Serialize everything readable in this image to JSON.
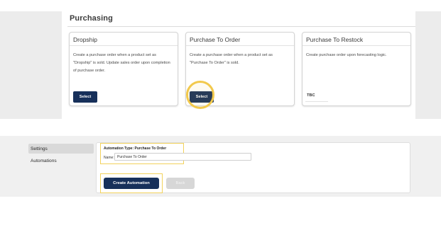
{
  "purchasing": {
    "title": "Purchasing",
    "cards": [
      {
        "title": "Dropship",
        "description": "Create a purchase order when a product set as \"Dropship\" is sold. Update sales order upon completion of purchase order.",
        "action_label": "Select"
      },
      {
        "title": "Purchase To Order",
        "description": "Create a purchase order when a product set as \"Purchase To Order\" is sold.",
        "action_label": "Select"
      },
      {
        "title": "Purchase To Restock",
        "description": "Create purchase order upon forecasting logic.",
        "action_label": "TBC"
      }
    ]
  },
  "sidebar": {
    "items": [
      {
        "label": "Settings",
        "active": true
      },
      {
        "label": "Automations",
        "active": false
      }
    ]
  },
  "automation_form": {
    "type_label": "Automation Type: Purchase To Order",
    "name_label": "Name:",
    "name_value": "Purchase To Order",
    "create_label": "Create Automation",
    "back_label": "Back"
  },
  "colors": {
    "primary_button": "#17305a",
    "highlight": "#f2c94c",
    "disabled_button": "#d7d7d7"
  }
}
